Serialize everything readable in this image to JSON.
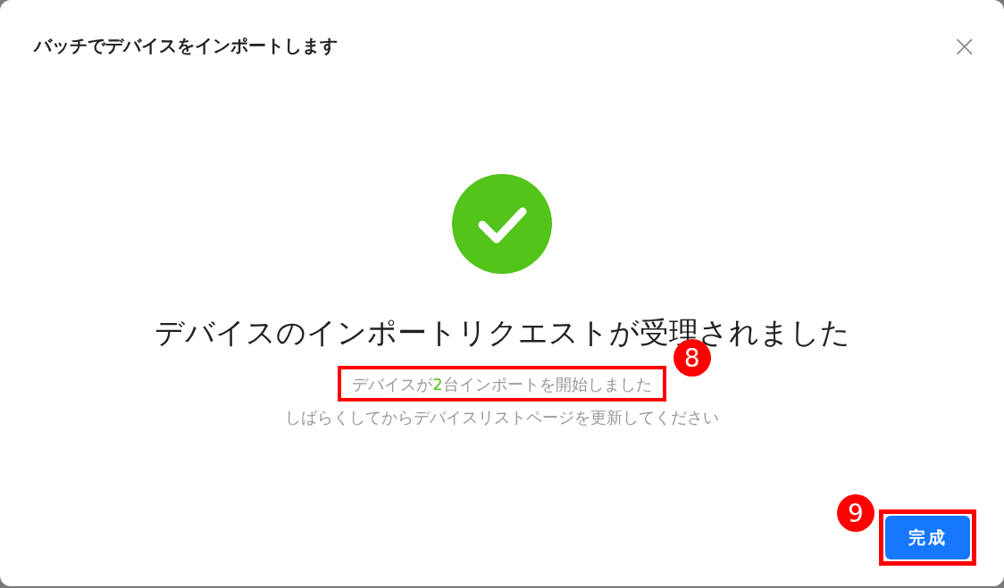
{
  "dialog": {
    "title": "バッチでデバイスをインポートします",
    "close": "×"
  },
  "result": {
    "heading": "デバイスのインポートリクエストが受理されました",
    "started": {
      "before": "デバイスが",
      "count": "2",
      "after": "台インポートを開始しました",
      "annotation": "8"
    },
    "hint": "しばらくしてからデバイスリストページを更新してください"
  },
  "footer": {
    "button": {
      "label": "完成",
      "annotation": "9"
    }
  }
}
